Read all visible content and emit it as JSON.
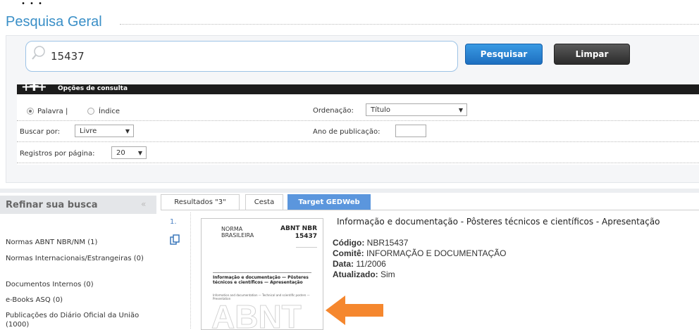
{
  "section_title": "Pesquisa Geral",
  "search": {
    "value": "15437",
    "button_search": "Pesquisar",
    "button_clear": "Limpar"
  },
  "options": {
    "header": "Opções de consulta",
    "mode_word": "Palavra |",
    "mode_index": "Índice",
    "selected_mode": "Palavra",
    "order_label": "Ordenação:",
    "order_value": "Título",
    "search_by_label": "Buscar por:",
    "search_by_value": "Livre",
    "year_label": "Ano de publicação:",
    "year_value": "",
    "per_page_label": "Registros por página:",
    "per_page_value": "20"
  },
  "refine": {
    "title": "Refinar sua busca",
    "facets": [
      "Normas ABNT NBR/NM (1)",
      "Normas Internacionais/Estrangeiras (0)",
      "Documentos Internos (0)",
      "e-Books ASQ (0)",
      "Publicações do Diário Oficial da União (1000)"
    ]
  },
  "tabs": [
    "Resultados \"3\"",
    "Cesta",
    "Target GEDWeb"
  ],
  "active_tab": "Target GEDWeb",
  "result": {
    "number": "1.",
    "title": "Informação e documentação - Pôsteres técnicos e científicos - Apresentação",
    "code_label": "Código:",
    "code": "NBR15437",
    "committee_label": "Comitê:",
    "committee": "INFORMAÇÃO E DOCUMENTAÇÃO",
    "date_label": "Data:",
    "date": "11/2006",
    "updated_label": "Atualizado:",
    "updated": "Sim",
    "thumbnail": {
      "left": "NORMA\nBRASILEIRA",
      "right_top": "ABNT NBR",
      "right_num": "15437",
      "title": "Informação e documentação — Pôsteres técnicos e científicos — Apresentação",
      "subtitle": "Information and documentation — Technical and scientific posters — Presentation",
      "watermark": "ABNT"
    }
  },
  "colors": {
    "accent": "#3a8fc7",
    "button_blue": "#1d6fc0",
    "tab_active": "#5b96dd",
    "annotation_arrow": "#f5872e"
  }
}
